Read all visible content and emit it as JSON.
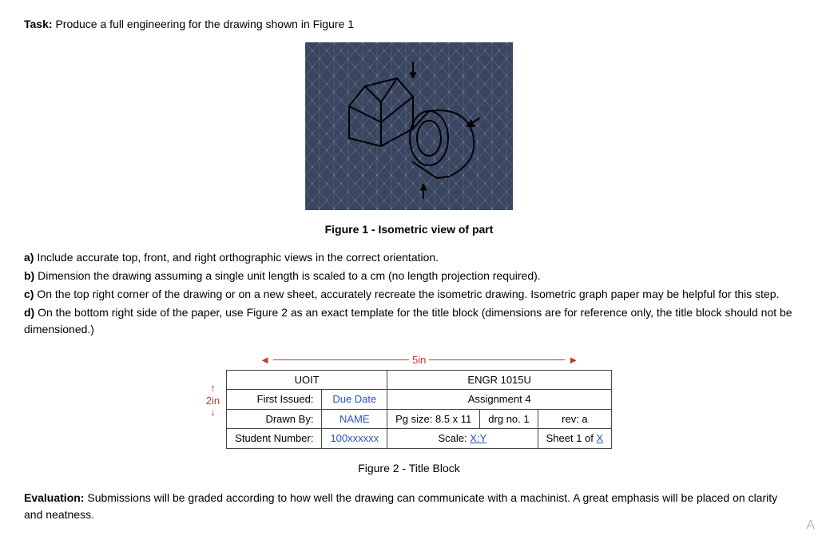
{
  "task": {
    "label": "Task:",
    "text": "Produce a full engineering for the drawing shown in Figure 1"
  },
  "figure1_caption": "Figure 1 - Isometric view of part",
  "instructions": {
    "a": {
      "label": "a)",
      "text": "Include accurate top, front, and right orthographic views in the correct orientation."
    },
    "b": {
      "label": "b)",
      "text": "Dimension the drawing assuming a single unit length is scaled to a cm (no length projection required)."
    },
    "c": {
      "label": "c)",
      "text": "On the top right corner of the drawing or on a new sheet, accurately recreate the isometric drawing. Isometric graph paper may be helpful for this step."
    },
    "d": {
      "label": "d)",
      "text": "On the bottom right side of the paper, use Figure 2 as an exact template for the title block (dimensions are for reference only, the title block should not be dimensioned.)"
    }
  },
  "dims": {
    "width": "5in",
    "height": "2in"
  },
  "title_block": {
    "r1c1": "UOIT",
    "r1c2": "ENGR 1015U",
    "r2c1_label": "First Issued:",
    "r2c1_value": "Due Date",
    "r2c2": "Assignment 4",
    "r3c1_label": "Drawn By:",
    "r3c1_value": "NAME",
    "r3c2_label": "Pg size: 8.5 x 11",
    "r3c2_value": "drg no. 1",
    "r3c3": "rev: a",
    "r4c1_label": "Student Number:",
    "r4c1_value": "100xxxxxx",
    "r4c2_label": "Scale: ",
    "r4c2_value": "X:Y",
    "r4c3_prefix": "Sheet 1 of ",
    "r4c3_value": "X"
  },
  "figure2_caption": "Figure 2 - Title Block",
  "evaluation": {
    "label": "Evaluation:",
    "text": "Submissions will be graded according to how well the drawing can communicate with a machinist. A great emphasis will be placed on clarity and neatness."
  },
  "corner": "A"
}
